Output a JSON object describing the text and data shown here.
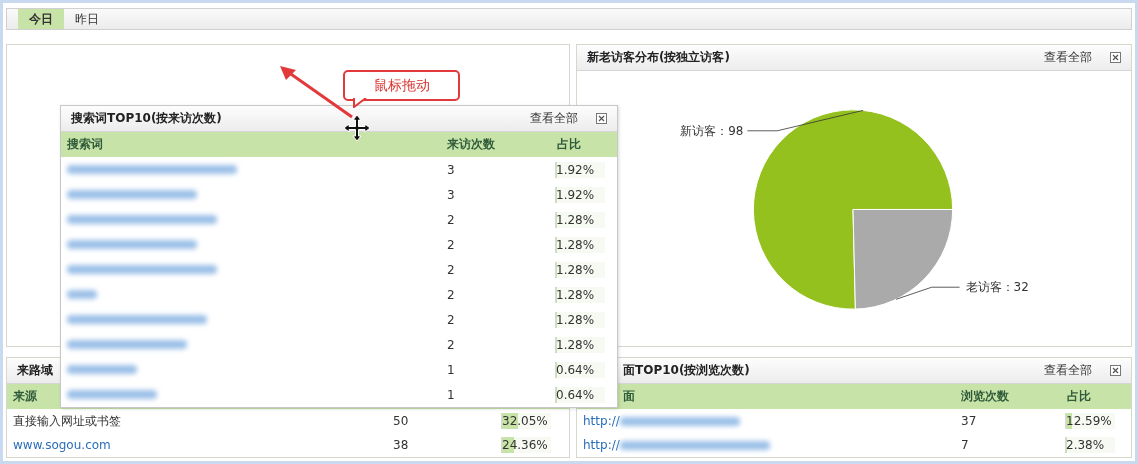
{
  "tabs": [
    {
      "label": "今日",
      "selected": true
    },
    {
      "label": "昨日",
      "selected": false
    }
  ],
  "visitor_panel": {
    "title": "新老访客分布(按独立访客)",
    "view_all": "查看全部",
    "label_separator": "：",
    "chart_data": {
      "type": "pie",
      "categories": [
        "新访客",
        "老访客"
      ],
      "series": [
        {
          "values": [
            98,
            32
          ]
        }
      ],
      "colors": [
        "#95c11f",
        "#aaaaaa"
      ],
      "data_labels": true
    }
  },
  "referrer_panel": {
    "title": "来路域",
    "columns": [
      "来源"
    ],
    "rows": [
      {
        "source": "直接输入网址或书签",
        "link": false,
        "count": "50",
        "percent": "32.05%",
        "level": 0.3205
      },
      {
        "source": "www.sogou.com",
        "link": true,
        "count": "38",
        "percent": "24.36%",
        "level": 0.2436
      }
    ]
  },
  "page_panel": {
    "title": "面TOP10(按浏览次数)",
    "view_all": "查看全部",
    "columns": [
      "面",
      "浏览次数",
      "占比"
    ],
    "rows": [
      {
        "url": "http://",
        "count": "37",
        "percent": "12.59%",
        "level": 0.1259
      },
      {
        "url": "http://",
        "count": "7",
        "percent": "2.38%",
        "level": 0.0238
      }
    ]
  },
  "search_panel": {
    "title": "搜索词TOP10(按来访次数)",
    "view_all": "查看全部",
    "columns": [
      "搜索词",
      "来访次数",
      "占比"
    ],
    "rows": [
      {
        "count": "3",
        "percent": "1.92%",
        "level": 0.0192
      },
      {
        "count": "3",
        "percent": "1.92%",
        "level": 0.0192
      },
      {
        "count": "2",
        "percent": "1.28%",
        "level": 0.0128
      },
      {
        "count": "2",
        "percent": "1.28%",
        "level": 0.0128
      },
      {
        "count": "2",
        "percent": "1.28%",
        "level": 0.0128
      },
      {
        "count": "2",
        "percent": "1.28%",
        "level": 0.0128
      },
      {
        "count": "2",
        "percent": "1.28%",
        "level": 0.0128
      },
      {
        "count": "2",
        "percent": "1.28%",
        "level": 0.0128
      },
      {
        "count": "1",
        "percent": "0.64%",
        "level": 0.0064
      },
      {
        "count": "1",
        "percent": "0.64%",
        "level": 0.0064
      }
    ]
  },
  "callout": {
    "text": "鼠标拖动"
  }
}
